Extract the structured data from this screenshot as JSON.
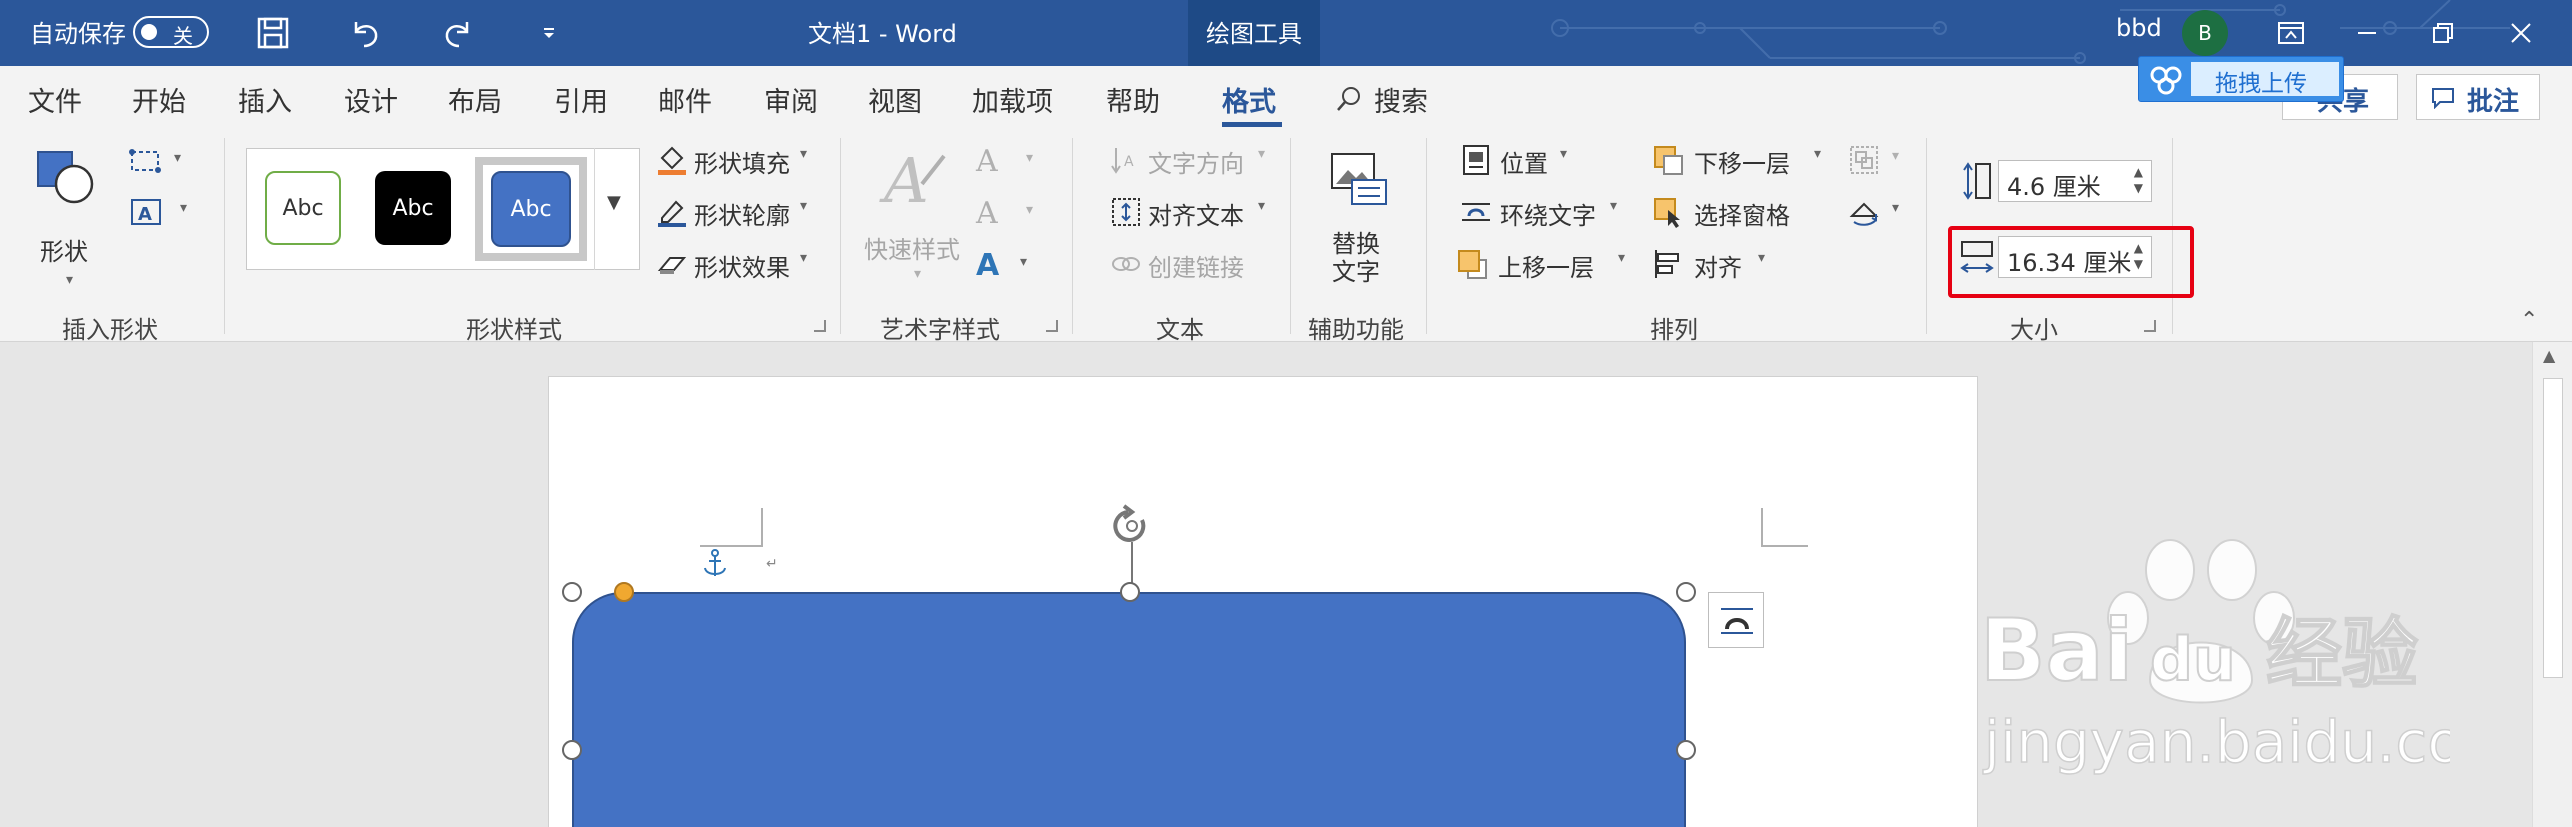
{
  "titlebar": {
    "autosave_label": "自动保存",
    "autosave_state": "关",
    "doc_title": "文档1  -  Word",
    "context_tab": "绘图工具",
    "user": "bbd",
    "avatar_initial": "B"
  },
  "tabs": [
    "文件",
    "开始",
    "插入",
    "设计",
    "布局",
    "引用",
    "邮件",
    "审阅",
    "视图",
    "加载项",
    "帮助",
    "格式"
  ],
  "search_label": "搜索",
  "share_label": "共享",
  "comment_label": "批注",
  "upload_label": "拖拽上传",
  "ribbon": {
    "insert_shapes": {
      "shape_label": "形状",
      "group_label": "插入形状"
    },
    "shape_styles": {
      "sample_text": "Abc",
      "fill": "形状填充",
      "outline": "形状轮廓",
      "effects": "形状效果",
      "group_label": "形状样式"
    },
    "wordart": {
      "quick_styles": "快速样式",
      "group_label": "艺术字样式"
    },
    "text": {
      "direction": "文字方向",
      "align": "对齐文本",
      "link": "创建链接",
      "group_label": "文本"
    },
    "accessibility": {
      "alt_text_1": "替换",
      "alt_text_2": "文字",
      "group_label": "辅助功能"
    },
    "arrange": {
      "position": "位置",
      "wrap": "环绕文字",
      "bring_forward": "上移一层",
      "send_backward": "下移一层",
      "selection_pane": "选择窗格",
      "align": "对齐",
      "group_label": "排列"
    },
    "size": {
      "height": "4.6 厘米",
      "width": "16.34 厘米",
      "group_label": "大小"
    }
  },
  "colors": {
    "title_bg": "#2b579a",
    "shape_fill": "#4472c4",
    "highlight": "#e60012"
  }
}
